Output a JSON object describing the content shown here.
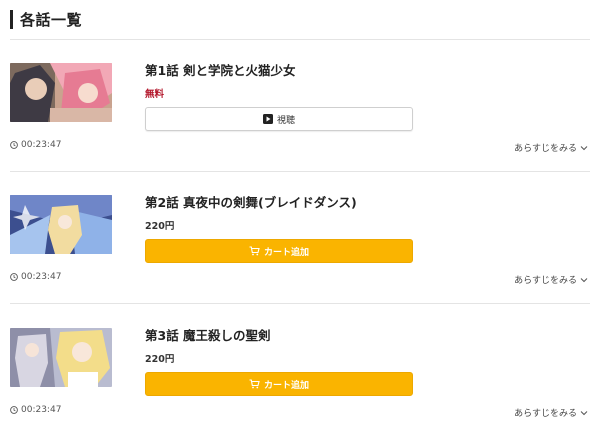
{
  "section": {
    "title": "各話一覧"
  },
  "episodes": [
    {
      "title": "第1話 剣と学院と火猫少女",
      "price": "無料",
      "free": true,
      "button": "視聴",
      "button_type": "watch",
      "duration": "00:23:47",
      "synopsis_link": "あらすじをみる",
      "thumb_icon": "episode-1-thumbnail"
    },
    {
      "title": "第2話 真夜中の剣舞(ブレイドダンス)",
      "price": "220円",
      "free": false,
      "button": "カート追加",
      "button_type": "cart",
      "duration": "00:23:47",
      "synopsis_link": "あらすじをみる",
      "thumb_icon": "episode-2-thumbnail"
    },
    {
      "title": "第3話 魔王殺しの聖剣",
      "price": "220円",
      "free": false,
      "button": "カート追加",
      "button_type": "cart",
      "duration": "00:23:47",
      "synopsis_link": "あらすじをみる",
      "thumb_icon": "episode-3-thumbnail"
    }
  ],
  "colors": {
    "cart_button": "#fab400",
    "free_price": "#b3182c",
    "divider": "#e4e4e4"
  },
  "icons": {
    "watch": "play-icon",
    "cart": "cart-icon",
    "duration": "clock-icon",
    "synopsis": "chevron-down-icon"
  }
}
